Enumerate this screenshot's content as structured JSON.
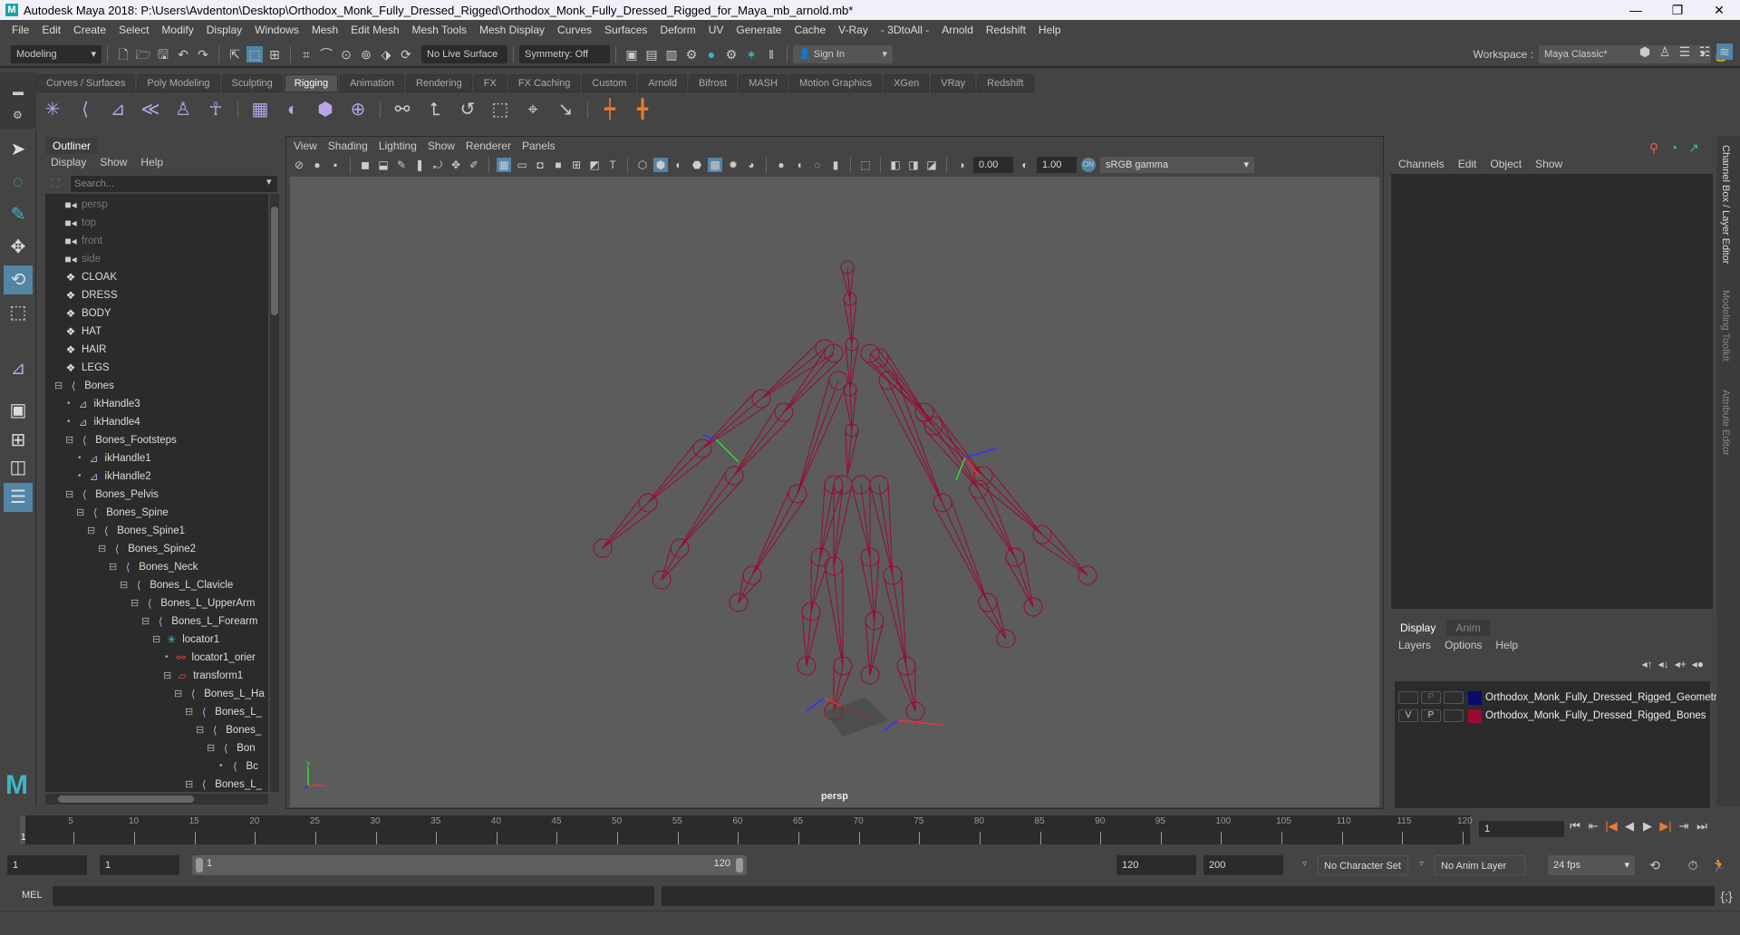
{
  "window": {
    "title": "Autodesk Maya 2018: P:\\Users\\Avdenton\\Desktop\\Orthodox_Monk_Fully_Dressed_Rigged\\Orthodox_Monk_Fully_Dressed_Rigged_for_Maya_mb_arnold.mb*",
    "logo": "M",
    "minimize": "—",
    "maximize": "❐",
    "close": "✕"
  },
  "menubar": [
    "File",
    "Edit",
    "Create",
    "Select",
    "Modify",
    "Display",
    "Windows",
    "Mesh",
    "Edit Mesh",
    "Mesh Tools",
    "Mesh Display",
    "Curves",
    "Surfaces",
    "Deform",
    "UV",
    "Generate",
    "Cache",
    "V-Ray",
    "- 3DtoAll -",
    "Arnold",
    "Redshift",
    "Help"
  ],
  "statusline": {
    "mode": "Modeling",
    "live_surface": "No Live Surface",
    "symmetry": "Symmetry: Off",
    "sign_in": "Sign In",
    "workspace_label": "Workspace :",
    "workspace_value": "Maya Classic*"
  },
  "shelf": {
    "tabs": [
      "Curves / Surfaces",
      "Poly Modeling",
      "Sculpting",
      "Rigging",
      "Animation",
      "Rendering",
      "FX",
      "FX Caching",
      "Custom",
      "Arnold",
      "Bifrost",
      "MASH",
      "Motion Graphics",
      "XGen",
      "VRay",
      "Redshift"
    ],
    "active_tab": "Rigging",
    "icons": [
      {
        "name": "create-joints-icon",
        "glyph": "✳",
        "color": "purple"
      },
      {
        "name": "insert-joint-icon",
        "glyph": "⟨",
        "color": "purple"
      },
      {
        "name": "ik-handle-icon",
        "glyph": "⊿",
        "color": "purple"
      },
      {
        "name": "ik-spline-icon",
        "glyph": "≪",
        "color": "purple"
      },
      {
        "name": "quick-rig-icon",
        "glyph": "♙",
        "color": "purple"
      },
      {
        "name": "human-ik-icon",
        "glyph": "☥",
        "color": "purple"
      },
      {
        "name": "bind-skin-icon",
        "glyph": "▦",
        "color": "purple"
      },
      {
        "name": "smooth-bind-icon",
        "glyph": "◐",
        "color": "purple"
      },
      {
        "name": "lattice-icon",
        "glyph": "⬢",
        "color": "purple"
      },
      {
        "name": "cluster-icon",
        "glyph": "⊕",
        "color": "purple"
      },
      {
        "name": "parent-constraint-icon",
        "glyph": "⚯",
        "color": "grey"
      },
      {
        "name": "point-constraint-icon",
        "glyph": "⮤",
        "color": "grey"
      },
      {
        "name": "orient-constraint-icon",
        "glyph": "↺",
        "color": "grey"
      },
      {
        "name": "scale-constraint-icon",
        "glyph": "⬚",
        "color": "grey"
      },
      {
        "name": "aim-constraint-icon",
        "glyph": "⌖",
        "color": "grey"
      },
      {
        "name": "pole-vector-icon",
        "glyph": "↘",
        "color": "grey"
      },
      {
        "name": "set-key-icon",
        "glyph": "┿",
        "color": "orange"
      },
      {
        "name": "set-driven-key-icon",
        "glyph": "╋",
        "color": "orange"
      }
    ]
  },
  "toolbox": [
    "select-tool",
    "lasso-tool",
    "paint-select-tool",
    "move-tool",
    "rotate-tool",
    "scale-tool",
    "ik-handle-tool",
    "single-pane-layout",
    "four-pane-layout",
    "two-pane-layout",
    "outliner-layout"
  ],
  "outliner": {
    "title": "Outliner",
    "menu": [
      "Display",
      "Show",
      "Help"
    ],
    "search_placeholder": "Search...",
    "items": [
      {
        "label": "persp",
        "depth": 0,
        "icon": "camera",
        "dim": true
      },
      {
        "label": "top",
        "depth": 0,
        "icon": "camera",
        "dim": true
      },
      {
        "label": "front",
        "depth": 0,
        "icon": "camera",
        "dim": true
      },
      {
        "label": "side",
        "depth": 0,
        "icon": "camera",
        "dim": true
      },
      {
        "label": "CLOAK",
        "depth": 0,
        "icon": "mesh"
      },
      {
        "label": "DRESS",
        "depth": 0,
        "icon": "mesh"
      },
      {
        "label": "BODY",
        "depth": 0,
        "icon": "mesh"
      },
      {
        "label": "HAT",
        "depth": 0,
        "icon": "mesh"
      },
      {
        "label": "HAIR",
        "depth": 0,
        "icon": "mesh"
      },
      {
        "label": "LEGS",
        "depth": 0,
        "icon": "mesh"
      },
      {
        "label": "Bones",
        "depth": 0,
        "icon": "joint",
        "expand": true
      },
      {
        "label": "ikHandle3",
        "depth": 1,
        "icon": "ik"
      },
      {
        "label": "ikHandle4",
        "depth": 1,
        "icon": "ik"
      },
      {
        "label": "Bones_Footsteps",
        "depth": 1,
        "icon": "joint",
        "expand": true
      },
      {
        "label": "ikHandle1",
        "depth": 2,
        "icon": "ik"
      },
      {
        "label": "ikHandle2",
        "depth": 2,
        "icon": "ik"
      },
      {
        "label": "Bones_Pelvis",
        "depth": 1,
        "icon": "joint",
        "expand": true
      },
      {
        "label": "Bones_Spine",
        "depth": 2,
        "icon": "joint",
        "expand": true
      },
      {
        "label": "Bones_Spine1",
        "depth": 3,
        "icon": "joint",
        "expand": true
      },
      {
        "label": "Bones_Spine2",
        "depth": 4,
        "icon": "joint",
        "expand": true
      },
      {
        "label": "Bones_Neck",
        "depth": 5,
        "icon": "joint",
        "expand": true
      },
      {
        "label": "Bones_L_Clavicle",
        "depth": 6,
        "icon": "joint",
        "expand": true
      },
      {
        "label": "Bones_L_UpperArm",
        "depth": 7,
        "icon": "joint",
        "expand": true
      },
      {
        "label": "Bones_L_Forearm",
        "depth": 8,
        "icon": "joint",
        "expand": true
      },
      {
        "label": "locator1",
        "depth": 9,
        "icon": "locator",
        "expand": true
      },
      {
        "label": "locator1_orier",
        "depth": 10,
        "icon": "constraint"
      },
      {
        "label": "transform1",
        "depth": 10,
        "icon": "transform",
        "expand": true
      },
      {
        "label": "Bones_L_Ha",
        "depth": 11,
        "icon": "joint",
        "expand": true
      },
      {
        "label": "Bones_L_",
        "depth": 12,
        "icon": "joint",
        "expand": true
      },
      {
        "label": "Bones_",
        "depth": 13,
        "icon": "joint",
        "expand": true
      },
      {
        "label": "Bon",
        "depth": 14,
        "icon": "joint",
        "expand": true
      },
      {
        "label": "Bc",
        "depth": 15,
        "icon": "joint"
      },
      {
        "label": "Bones_L_",
        "depth": 12,
        "icon": "joint",
        "expand": true
      }
    ]
  },
  "viewport": {
    "menu": [
      "View",
      "Shading",
      "Lighting",
      "Show",
      "Renderer",
      "Panels"
    ],
    "exposure": "0.00",
    "gamma": "1.00",
    "color_space": "sRGB gamma",
    "camera_label": "persp",
    "axis_labels": {
      "x": "x",
      "y": "y",
      "z": "z"
    }
  },
  "channelbox": {
    "menu": [
      "Channels",
      "Edit",
      "Object",
      "Show"
    ]
  },
  "layereditor": {
    "tabs": [
      "Display",
      "Anim"
    ],
    "active_tab": "Display",
    "menu": [
      "Layers",
      "Options",
      "Help"
    ],
    "layers": [
      {
        "v": "",
        "p": "P",
        "name": "Orthodox_Monk_Fully_Dressed_Rigged_Geometry",
        "color": "#0a0a6e"
      },
      {
        "v": "V",
        "p": "P",
        "name": "Orthodox_Monk_Fully_Dressed_Rigged_Bones",
        "color": "#9a0a32"
      }
    ]
  },
  "sidetabs": [
    "Channel Box / Layer Editor",
    "Modeling Toolkit",
    "Attribute Editor"
  ],
  "timeline": {
    "start": 1,
    "end": 120,
    "ticks": [
      5,
      10,
      15,
      20,
      25,
      30,
      35,
      40,
      45,
      50,
      55,
      60,
      65,
      70,
      75,
      80,
      85,
      90,
      95,
      100,
      105,
      110,
      115,
      120
    ],
    "current_frame": "1",
    "current_marker": "1"
  },
  "range": {
    "start": "1",
    "playback_start": "1",
    "slider_start": "1",
    "slider_end": "120",
    "playback_end": "120",
    "end": "200",
    "character_set": "No Character Set",
    "anim_layer": "No Anim Layer",
    "fps": "24 fps"
  },
  "playback": [
    "⏮",
    "⇤",
    "|◀",
    "◀",
    "▶",
    "▶|",
    "⇥",
    "⏭"
  ],
  "mel": {
    "label": "MEL"
  },
  "colors": {
    "bones": "#9a0a32",
    "accent": "#5285a6",
    "panel": "#444444",
    "field": "#2b2b2b"
  }
}
